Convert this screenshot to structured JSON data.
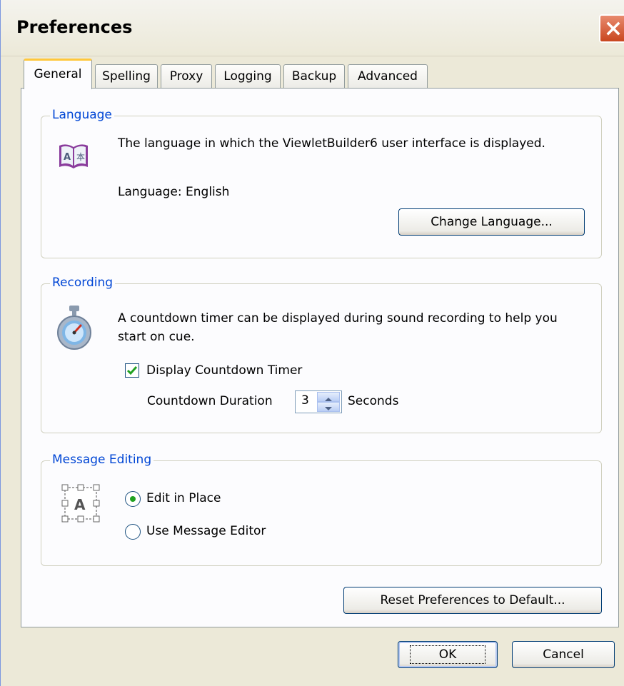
{
  "window": {
    "title": "Preferences"
  },
  "tabs": [
    {
      "label": "General",
      "active": true
    },
    {
      "label": "Spelling"
    },
    {
      "label": "Proxy"
    },
    {
      "label": "Logging"
    },
    {
      "label": "Backup"
    },
    {
      "label": "Advanced"
    }
  ],
  "language": {
    "group_label": "Language",
    "description": "The language in which the ViewletBuilder6 user interface is displayed.",
    "current": "Language:  English",
    "change_button": "Change Language..."
  },
  "recording": {
    "group_label": "Recording",
    "description": "A countdown timer can be displayed during sound recording to help you start on cue.",
    "checkbox_label": "Display Countdown Timer",
    "checkbox_checked": true,
    "duration_label": "Countdown Duration",
    "duration_value": "3",
    "duration_unit": "Seconds"
  },
  "message_editing": {
    "group_label": "Message Editing",
    "options": [
      {
        "label": "Edit in Place",
        "selected": true
      },
      {
        "label": "Use Message Editor",
        "selected": false
      }
    ]
  },
  "buttons": {
    "reset": "Reset Preferences to Default...",
    "ok": "OK",
    "cancel": "Cancel"
  },
  "icons": {
    "close": "close-icon",
    "language": "book-language-icon",
    "recording": "stopwatch-icon",
    "message": "text-box-icon"
  },
  "colors": {
    "group_label": "#0046d5",
    "active_tab_highlight": "#ffc83c",
    "close_button": "#c9461f"
  }
}
